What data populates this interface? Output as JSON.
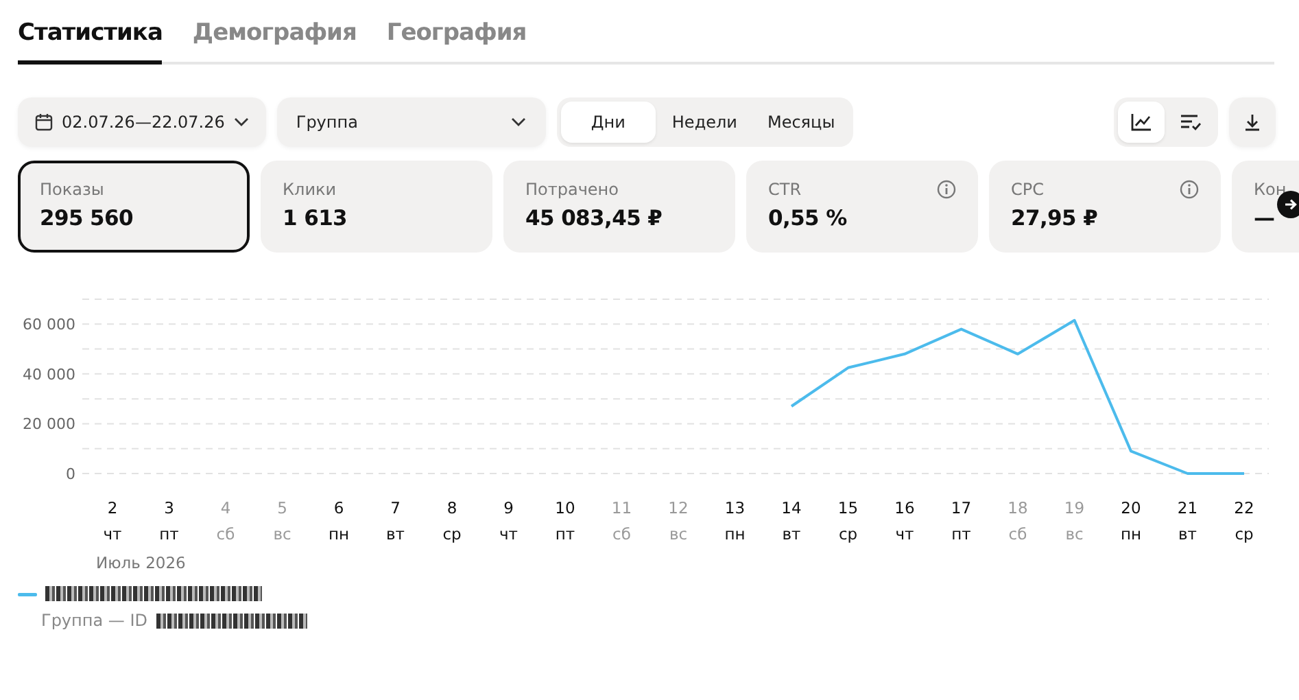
{
  "tabs": [
    {
      "label": "Статистика",
      "selected": true
    },
    {
      "label": "Демография",
      "selected": false
    },
    {
      "label": "География",
      "selected": false
    }
  ],
  "toolbar": {
    "date_range": "02.07.26—22.07.26",
    "grouping": "Группа",
    "periods": [
      {
        "label": "Дни",
        "selected": true
      },
      {
        "label": "Недели",
        "selected": false
      },
      {
        "label": "Месяцы",
        "selected": false
      }
    ],
    "views": [
      {
        "kind": "chart",
        "selected": true
      },
      {
        "kind": "table",
        "selected": false
      }
    ]
  },
  "metrics": [
    {
      "label": "Показы",
      "value": "295 560",
      "selected": true,
      "info": false
    },
    {
      "label": "Клики",
      "value": "1 613",
      "selected": false,
      "info": false
    },
    {
      "label": "Потрачено",
      "value": "45 083,45 ₽",
      "selected": false,
      "info": false
    },
    {
      "label": "CTR",
      "value": "0,55 %",
      "selected": false,
      "info": true
    },
    {
      "label": "CPC",
      "value": "27,95 ₽",
      "selected": false,
      "info": true
    },
    {
      "label": "Кон",
      "value": "—",
      "selected": false,
      "info": false
    }
  ],
  "weekdays": [
    {
      "label": "чт",
      "weekend": false
    },
    {
      "label": "пт",
      "weekend": false
    },
    {
      "label": "сб",
      "weekend": true
    },
    {
      "label": "вс",
      "weekend": true
    },
    {
      "label": "пн",
      "weekend": false
    },
    {
      "label": "вт",
      "weekend": false
    },
    {
      "label": "ср",
      "weekend": false
    },
    {
      "label": "чт",
      "weekend": false
    },
    {
      "label": "пт",
      "weekend": false
    },
    {
      "label": "сб",
      "weekend": true
    },
    {
      "label": "вс",
      "weekend": true
    },
    {
      "label": "пн",
      "weekend": false
    },
    {
      "label": "вт",
      "weekend": false
    },
    {
      "label": "ср",
      "weekend": false
    },
    {
      "label": "чт",
      "weekend": false
    },
    {
      "label": "пт",
      "weekend": false
    },
    {
      "label": "сб",
      "weekend": true
    },
    {
      "label": "вс",
      "weekend": true
    },
    {
      "label": "пн",
      "weekend": false
    },
    {
      "label": "вт",
      "weekend": false
    },
    {
      "label": "ср",
      "weekend": false
    }
  ],
  "month_label": "Июль 2026",
  "chart_data": {
    "type": "line",
    "grid": true,
    "categories": [
      "2",
      "3",
      "4",
      "5",
      "6",
      "7",
      "8",
      "9",
      "10",
      "11",
      "12",
      "13",
      "14",
      "15",
      "16",
      "17",
      "18",
      "19",
      "20",
      "21",
      "22"
    ],
    "ylim": [
      0,
      70000
    ],
    "yticks": [
      {
        "value": 0,
        "label": "0"
      },
      {
        "value": 20000,
        "label": "20 000"
      },
      {
        "value": 40000,
        "label": "40 000"
      },
      {
        "value": 60000,
        "label": "60 000"
      }
    ],
    "series": [
      {
        "color": "#4cbbec",
        "values": [
          null,
          null,
          null,
          null,
          null,
          null,
          null,
          null,
          null,
          null,
          null,
          null,
          27000,
          42500,
          48000,
          58000,
          48000,
          61500,
          9000,
          0,
          0
        ]
      }
    ]
  },
  "legend": {
    "subtitle": "Группа — ID"
  }
}
